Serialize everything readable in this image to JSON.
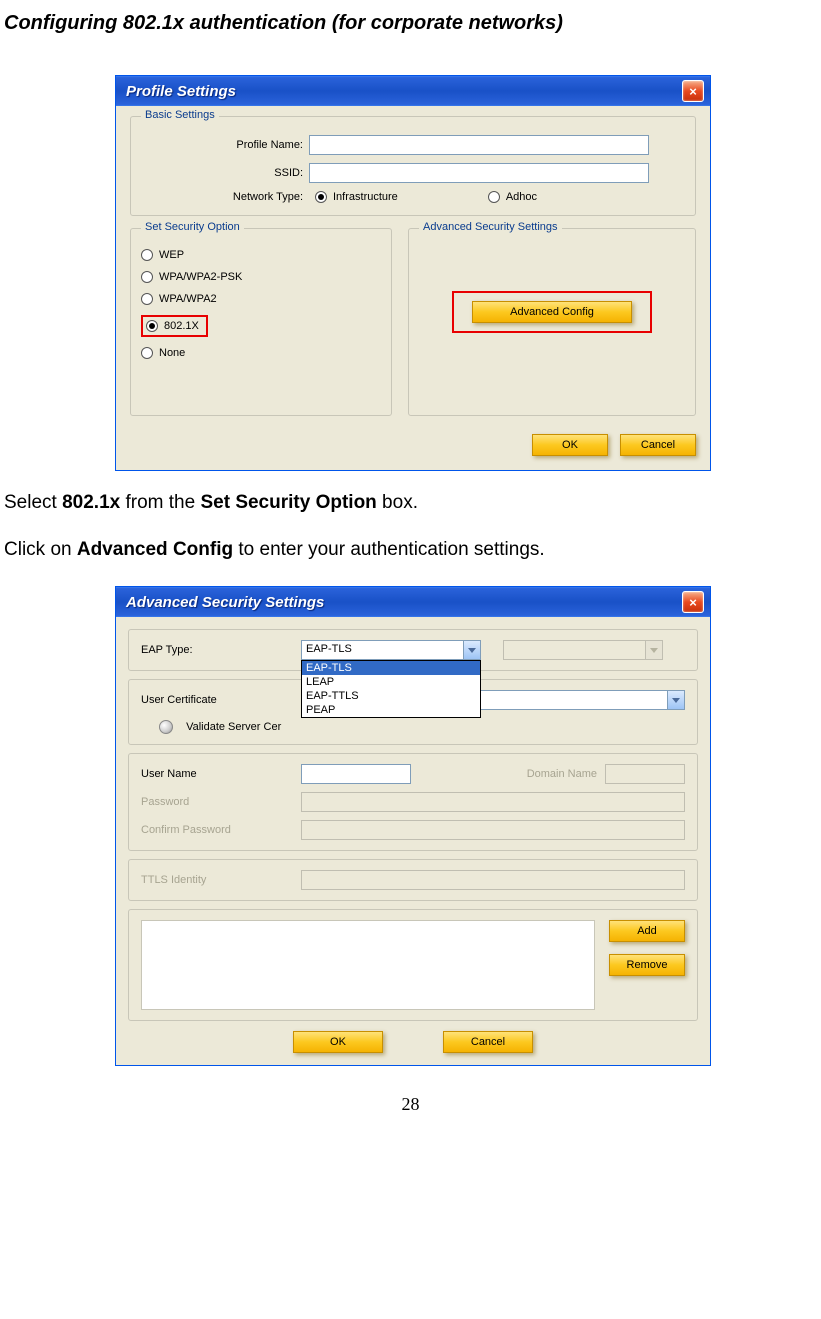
{
  "heading": "Configuring 802.1x authentication (for corporate networks)",
  "text1_pre": "Select ",
  "text1_b1": "802.1x",
  "text1_mid": " from the ",
  "text1_b2": "Set Security Option",
  "text1_post": " box.",
  "text2_pre": "Click on ",
  "text2_b1": "Advanced Config",
  "text2_post": " to enter your authentication settings.",
  "page_number": "28",
  "window1": {
    "title": "Profile Settings",
    "basic": {
      "legend": "Basic Settings",
      "profile_name_label": "Profile Name:",
      "ssid_label": "SSID:",
      "network_type_label": "Network Type:",
      "infra_label": "Infrastructure",
      "adhoc_label": "Adhoc"
    },
    "security": {
      "legend": "Set Security Option",
      "options": [
        "WEP",
        "WPA/WPA2-PSK",
        "WPA/WPA2",
        "802.1X",
        "None"
      ],
      "selected_index": 3
    },
    "advanced": {
      "legend": "Advanced Security Settings",
      "button": "Advanced Config"
    },
    "ok": "OK",
    "cancel": "Cancel"
  },
  "window2": {
    "title": "Advanced Security Settings",
    "eap_label": "EAP Type:",
    "eap_value": "EAP-TLS",
    "eap_options": [
      "EAP-TLS",
      "LEAP",
      "EAP-TTLS",
      "PEAP"
    ],
    "user_cert_label": "User Certificate",
    "validate_label": "Validate Server Cer",
    "user_name_label": "User Name",
    "domain_name_label": "Domain Name",
    "password_label": "Password",
    "confirm_password_label": "Confirm Password",
    "ttls_label": "TTLS Identity",
    "add": "Add",
    "remove": "Remove",
    "ok": "OK",
    "cancel": "Cancel"
  }
}
